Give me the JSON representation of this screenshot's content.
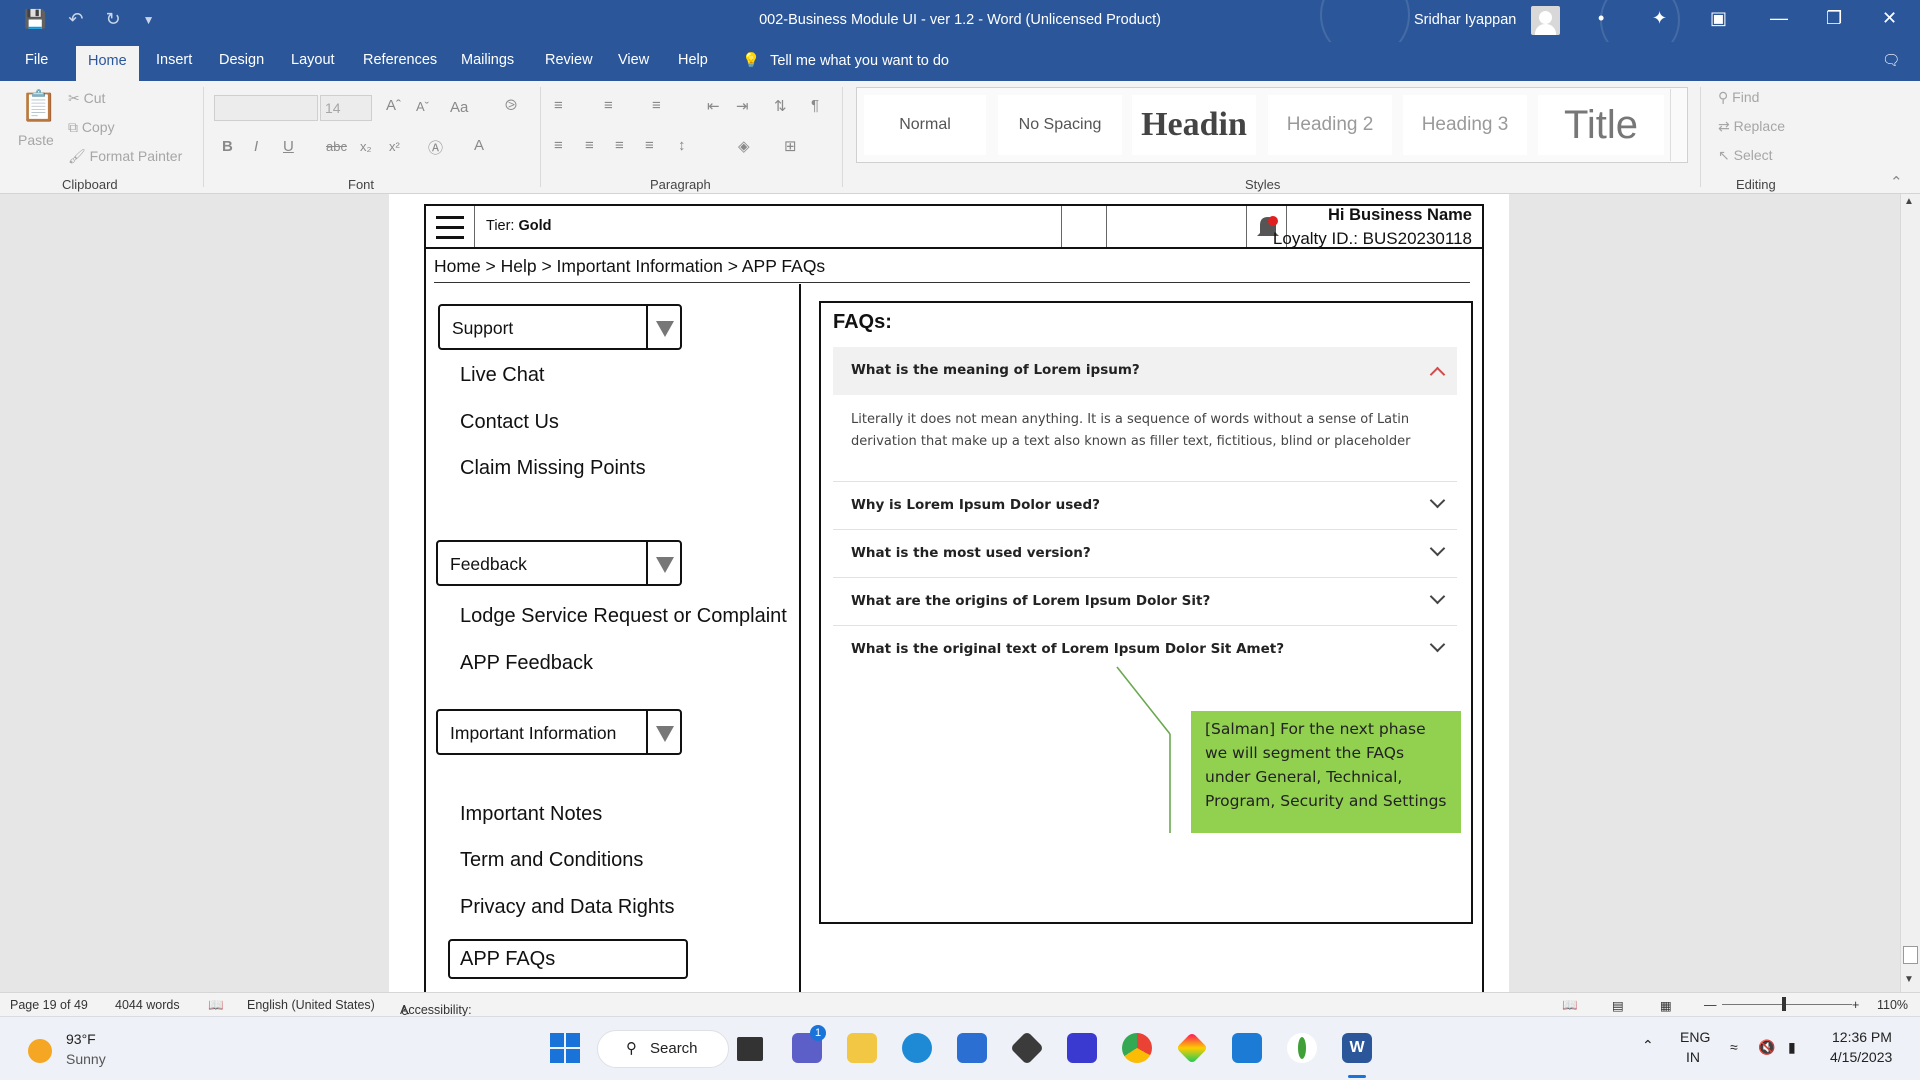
{
  "window": {
    "title": "002-Business Module UI - ver 1.2  -  Word (Unlicensed Product)",
    "user_name": "Sridhar Iyappan"
  },
  "ribbon_tabs": [
    "File",
    "Home",
    "Insert",
    "Design",
    "Layout",
    "References",
    "Mailings",
    "Review",
    "View",
    "Help"
  ],
  "tell_me": "Tell me what you want to do",
  "ribbon": {
    "clipboard": {
      "paste": "Paste",
      "cut": "Cut",
      "copy": "Copy",
      "format_painter": "Format Painter",
      "label": "Clipboard"
    },
    "font": {
      "size": "14",
      "label": "Font"
    },
    "paragraph": {
      "label": "Paragraph"
    },
    "styles": {
      "label": "Styles",
      "items": [
        "Normal",
        "No Spacing",
        "Headin",
        "Heading 2",
        "Heading 3",
        "Title"
      ]
    },
    "editing": {
      "find": "Find",
      "replace": "Replace",
      "select": "Select",
      "label": "Editing"
    }
  },
  "mock": {
    "tier_label": "Tier:",
    "tier_value": "Gold",
    "greeting": "Hi Business Name",
    "loyalty": "Loyalty ID.: BUS20230118",
    "breadcrumb": "Home > Help > Important Information > APP FAQs",
    "sections": [
      {
        "title": "Support",
        "links": [
          "Live Chat",
          "Contact Us",
          "Claim Missing Points"
        ]
      },
      {
        "title": "Feedback",
        "links": [
          "Lodge Service Request or Complaint",
          "APP Feedback"
        ]
      },
      {
        "title": "Important Information",
        "links": [
          "Important Notes",
          "Term and Conditions",
          "Privacy and Data Rights",
          "APP FAQs"
        ]
      }
    ],
    "faq": {
      "title": "FAQs:",
      "items": [
        {
          "question": "What is the meaning of Lorem ipsum?",
          "answer": "Literally it does not mean anything. It is a sequence of words without a sense of Latin derivation that make up a text also known as filler text, fictitious, blind or placeholder",
          "expanded": true
        },
        {
          "question": "Why is Lorem Ipsum Dolor used?"
        },
        {
          "question": "What is the most used version?"
        },
        {
          "question": "What are the origins of Lorem Ipsum Dolor Sit?"
        },
        {
          "question": "What is the original text of Lorem Ipsum Dolor Sit Amet?"
        }
      ]
    },
    "comment": "[Salman] For the next phase we will segment the FAQs under General, Technical, Program, Security and  Settings"
  },
  "status": {
    "page": "Page 19 of 49",
    "words": "4044 words",
    "language": "English (United States)",
    "accessibility": "Accessibility: Investigate",
    "zoom": "110%"
  },
  "taskbar": {
    "weather_temp": "93°F",
    "weather_desc": "Sunny",
    "search": "Search",
    "lang": "ENG",
    "region": "IN",
    "time": "12:36 PM",
    "date": "4/15/2023",
    "chat_badge": "1"
  },
  "colors": {
    "word_blue": "#2b579a",
    "comment_green": "#92d050",
    "active_chevron": "#d24b4b"
  }
}
